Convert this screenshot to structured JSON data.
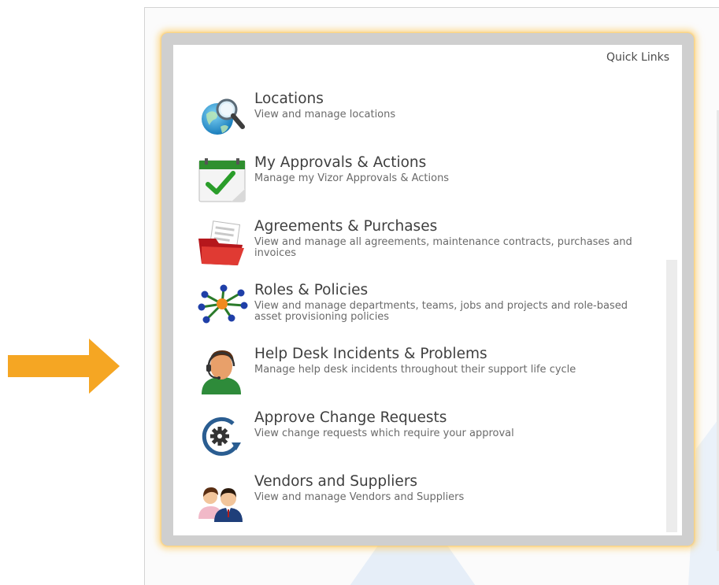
{
  "panel": {
    "title": "Quick Links"
  },
  "accent_color": "#f5a623",
  "items": [
    {
      "icon": "globe-search-icon",
      "title": "Locations",
      "description": "View and manage locations"
    },
    {
      "icon": "calendar-check-icon",
      "title": "My Approvals & Actions",
      "description": "Manage my Vizor Approvals & Actions"
    },
    {
      "icon": "red-folder-icon",
      "title": "Agreements & Purchases",
      "description": "View and manage all agreements, maintenance contracts, purchases and invoices"
    },
    {
      "icon": "network-nodes-icon",
      "title": "Roles & Policies",
      "description": "View and manage departments, teams, jobs and projects and role-based asset provisioning policies"
    },
    {
      "icon": "support-agent-icon",
      "title": "Help Desk Incidents & Problems",
      "description": "Manage help desk incidents throughout their support life cycle"
    },
    {
      "icon": "gear-refresh-icon",
      "title": "Approve Change Requests",
      "description": "View change requests which require your approval"
    },
    {
      "icon": "people-icon",
      "title": "Vendors and Suppliers",
      "description": "View and manage Vendors and Suppliers"
    }
  ]
}
